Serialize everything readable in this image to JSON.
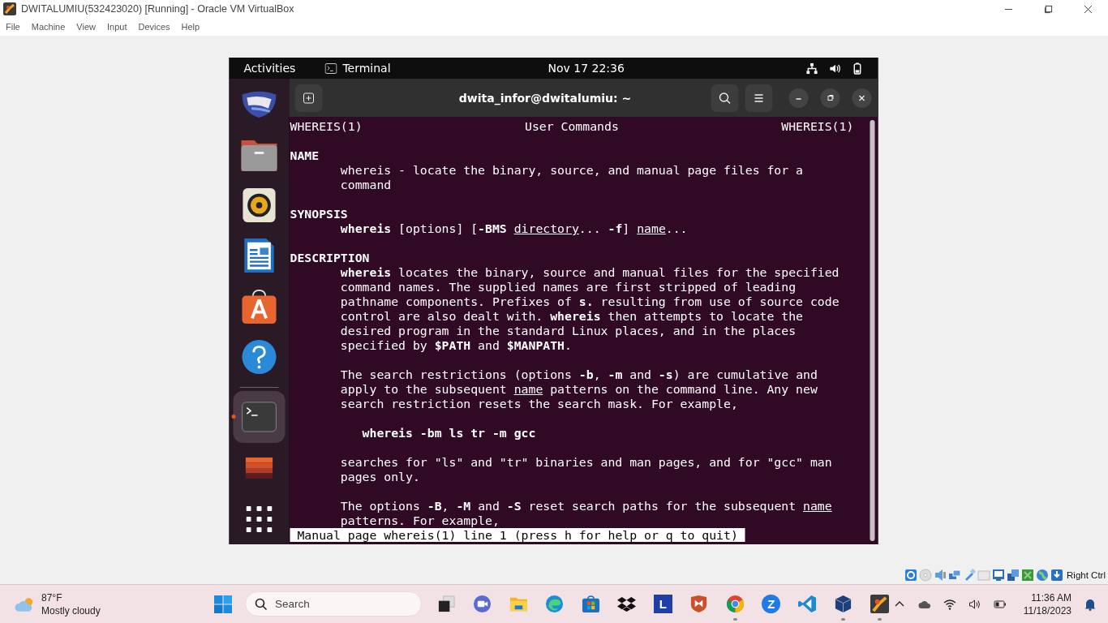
{
  "vbox": {
    "title": "DWITALUMIU(532423020) [Running] - Oracle VM VirtualBox",
    "menu": [
      "File",
      "Machine",
      "View",
      "Input",
      "Devices",
      "Help"
    ],
    "host_key": "Right Ctrl"
  },
  "gnome_bar": {
    "activities": "Activities",
    "app": "Terminal",
    "clock": "Nov 17  22:36"
  },
  "dock": [
    {
      "kind": "shell",
      "selected": false,
      "running": false
    },
    {
      "kind": "files",
      "selected": false,
      "running": false
    },
    {
      "kind": "speaker",
      "selected": false,
      "running": false
    },
    {
      "kind": "writer",
      "selected": false,
      "running": false
    },
    {
      "kind": "store",
      "selected": false,
      "running": false
    },
    {
      "kind": "help",
      "selected": false,
      "running": false
    },
    {
      "kind": "separator"
    },
    {
      "kind": "terminal",
      "selected": true,
      "running": true
    },
    {
      "kind": "stripes",
      "selected": false,
      "running": false
    },
    {
      "kind": "grid",
      "selected": false,
      "running": false
    }
  ],
  "terminal": {
    "title": "dwita_infor@dwitalumiu: ~",
    "header": {
      "left": "WHEREIS(1)",
      "center": "User Commands",
      "right": "WHEREIS(1)"
    },
    "lines": [
      {
        "kind": "blank"
      },
      {
        "kind": "heading",
        "segments": [
          {
            "kind": "text",
            "text": "NAME"
          }
        ]
      },
      {
        "kind": "body",
        "segments": [
          {
            "kind": "text",
            "text": "whereis - locate the binary, source, and manual page files for a"
          }
        ]
      },
      {
        "kind": "body",
        "segments": [
          {
            "kind": "text",
            "text": "command"
          }
        ]
      },
      {
        "kind": "blank"
      },
      {
        "kind": "heading",
        "segments": [
          {
            "kind": "text",
            "text": "SYNOPSIS"
          }
        ]
      },
      {
        "kind": "body",
        "segments": [
          {
            "kind": "text",
            "text": "**whereis** [options] [**-BMS** "
          },
          {
            "kind": "underline",
            "text": "directory"
          },
          {
            "kind": "text",
            "text": "... **-f**] "
          },
          {
            "kind": "underline",
            "text": "name"
          },
          {
            "kind": "text",
            "text": "..."
          }
        ]
      },
      {
        "kind": "blank"
      },
      {
        "kind": "heading",
        "segments": [
          {
            "kind": "text",
            "text": "DESCRIPTION"
          }
        ]
      },
      {
        "kind": "body",
        "segments": [
          {
            "kind": "text",
            "text": "**whereis** locates the binary, source and manual files for the specified"
          }
        ]
      },
      {
        "kind": "body",
        "segments": [
          {
            "kind": "text",
            "text": "command names. The supplied names are first stripped of leading"
          }
        ]
      },
      {
        "kind": "body",
        "segments": [
          {
            "kind": "text",
            "text": "pathname components. Prefixes of **s.** resulting from use of source code"
          }
        ]
      },
      {
        "kind": "body",
        "segments": [
          {
            "kind": "text",
            "text": "control are also dealt with. **whereis** then attempts to locate the"
          }
        ]
      },
      {
        "kind": "body",
        "segments": [
          {
            "kind": "text",
            "text": "desired program in the standard Linux places, and in the places"
          }
        ]
      },
      {
        "kind": "body",
        "segments": [
          {
            "kind": "text",
            "text": "specified by **$PATH** and **$MANPATH**."
          }
        ]
      },
      {
        "kind": "blank"
      },
      {
        "kind": "body",
        "segments": [
          {
            "kind": "text",
            "text": "The search restrictions (options **-b**, **-m** and **-s**) are cumulative and"
          }
        ]
      },
      {
        "kind": "body",
        "segments": [
          {
            "kind": "text",
            "text": "apply to the subsequent "
          },
          {
            "kind": "underline",
            "text": "name"
          },
          {
            "kind": "text",
            "text": " patterns on the command line. Any new"
          }
        ]
      },
      {
        "kind": "body",
        "segments": [
          {
            "kind": "text",
            "text": "search restriction resets the search mask. For example,"
          }
        ]
      },
      {
        "kind": "blank"
      },
      {
        "kind": "example",
        "segments": [
          {
            "kind": "text",
            "text": "whereis -bm ls tr -m gcc"
          }
        ]
      },
      {
        "kind": "blank"
      },
      {
        "kind": "body",
        "segments": [
          {
            "kind": "text",
            "text": "searches for \"ls\" and \"tr\" binaries and man pages, and for \"gcc\" man"
          }
        ]
      },
      {
        "kind": "body",
        "segments": [
          {
            "kind": "text",
            "text": "pages only."
          }
        ]
      },
      {
        "kind": "blank"
      },
      {
        "kind": "body",
        "segments": [
          {
            "kind": "text",
            "text": "The options **-B**, **-M** and **-S** reset search paths for the subsequent "
          },
          {
            "kind": "underline",
            "text": "name"
          }
        ]
      },
      {
        "kind": "body",
        "segments": [
          {
            "kind": "text",
            "text": "patterns. For example,"
          }
        ]
      }
    ],
    "status": " Manual page whereis(1) line 1 (press h for help or q to quit)"
  },
  "taskbar": {
    "weather": {
      "temp": "87°F",
      "desc": "Mostly cloudy"
    },
    "search": {
      "placeholder": "Search"
    },
    "apps": [
      {
        "kind": "taskview",
        "running": false
      },
      {
        "kind": "meet",
        "running": false
      },
      {
        "kind": "explorer",
        "running": false
      },
      {
        "kind": "edge",
        "running": false
      },
      {
        "kind": "store",
        "running": false
      },
      {
        "kind": "dropbox",
        "running": false
      },
      {
        "kind": "letter",
        "label": "L",
        "running": false
      },
      {
        "kind": "shield",
        "running": false
      },
      {
        "kind": "chrome",
        "running": true
      },
      {
        "kind": "zoom",
        "label": "Z",
        "running": false
      },
      {
        "kind": "vscode",
        "running": false
      },
      {
        "kind": "virtualbox",
        "running": true
      },
      {
        "kind": "vm",
        "running": true
      }
    ],
    "time": "11:36 AM",
    "date": "11/18/2023"
  }
}
